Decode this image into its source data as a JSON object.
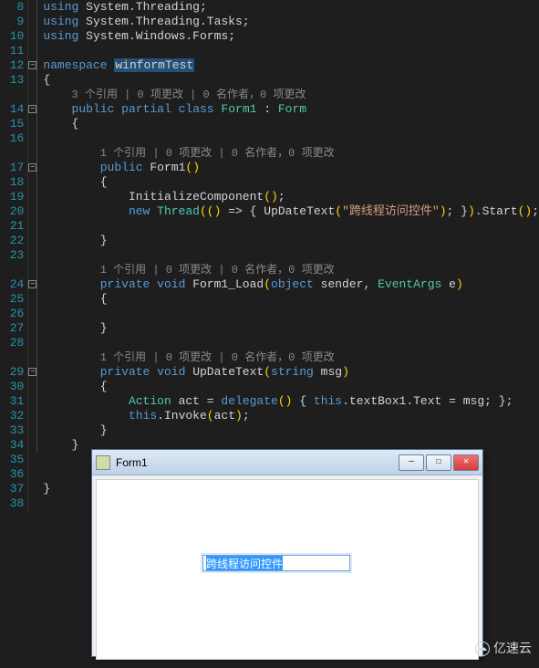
{
  "lines": {
    "start": 8,
    "numbers": [
      8,
      9,
      10,
      11,
      12,
      13,
      null,
      14,
      15,
      16,
      null,
      17,
      18,
      19,
      20,
      21,
      22,
      23,
      null,
      24,
      25,
      26,
      27,
      28,
      null,
      29,
      30,
      31,
      32,
      33,
      34,
      35,
      36,
      37,
      38
    ]
  },
  "code": {
    "l8_kw": "using",
    "l8_ns": "System.Threading",
    "l9_kw": "using",
    "l9_ns": "System.Threading.Tasks",
    "l10_kw": "using",
    "l10_ns": "System.Windows.Forms",
    "l12_kw": "namespace",
    "l12_ns": "winformTest",
    "lens1": "3 个引用 | 0 项更改 | 0 名作者，0 项更改",
    "l14_public": "public",
    "l14_partial": "partial",
    "l14_class": "class",
    "l14_Form1": "Form1",
    "l14_Form": "Form",
    "lens2": "1 个引用 | 0 项更改 | 0 名作者，0 项更改",
    "l17_public": "public",
    "l17_Form1": "Form1",
    "l19_init": "InitializeComponent",
    "l20_new": "new",
    "l20_Thread": "Thread",
    "l20_UpDateText": "UpDateText",
    "l20_str": "\"跨线程访问控件\"",
    "l20_Start": ".Start",
    "lens3": "1 个引用 | 0 项更改 | 0 名作者，0 项更改",
    "l24_private": "private",
    "l24_void": "void",
    "l24_name": "Form1_Load",
    "l24_object": "object",
    "l24_sender": "sender",
    "l24_EventArgs": "EventArgs",
    "l24_e": "e",
    "lens4": "1 个引用 | 0 项更改 | 0 名作者，0 项更改",
    "l29_private": "private",
    "l29_void": "void",
    "l29_name": "UpDateText",
    "l29_string": "string",
    "l29_msg": "msg",
    "l31_Action": "Action",
    "l31_act": "act",
    "l31_delegate": "delegate",
    "l31_this": "this",
    "l31_tb": ".textBox1.Text = msg",
    "l32_this": "this",
    "l32_invoke": ".Invoke",
    "l32_act": "act"
  },
  "winform": {
    "title": "Form1",
    "textbox_value": "跨线程访问控件",
    "min_glyph": "—",
    "max_glyph": "☐",
    "close_glyph": "✕"
  },
  "watermark": "亿速云"
}
